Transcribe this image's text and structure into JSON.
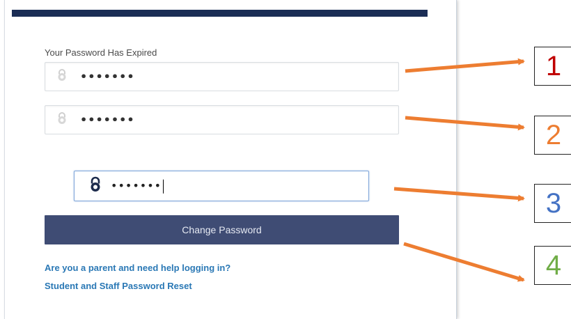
{
  "form": {
    "title": "Your Password Has Expired",
    "current_password_value": "•••••••",
    "new_password_value": "•••••••",
    "confirm_password_value": "•••••••",
    "submit_label": "Change Password",
    "parent_help_link": "Are you a parent and need help logging in?",
    "reset_link": "Student and Staff Password Reset"
  },
  "callouts": [
    {
      "label": "1",
      "color": "#c00000"
    },
    {
      "label": "2",
      "color": "#ed7d31"
    },
    {
      "label": "3",
      "color": "#4472c4"
    },
    {
      "label": "4",
      "color": "#70ad47"
    }
  ],
  "colors": {
    "header_bar": "#1b2d55",
    "button": "#3f4c74",
    "link": "#2a78b5",
    "arrow": "#ed7d31"
  },
  "icons": {
    "field_icon": "lock-icon"
  }
}
